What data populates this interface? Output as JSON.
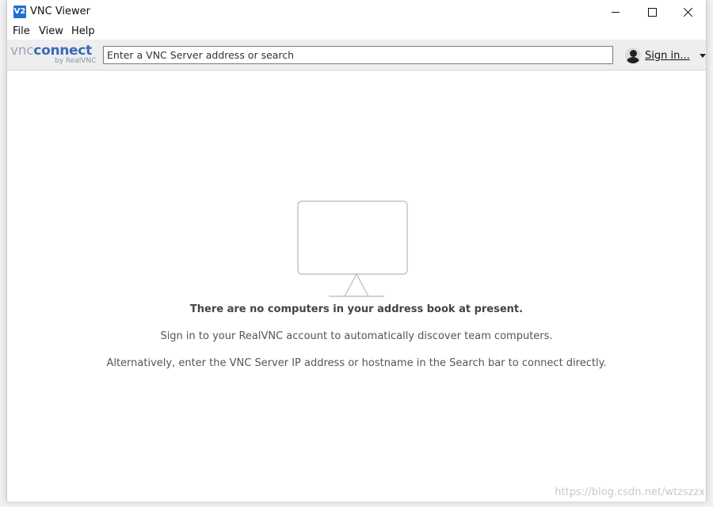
{
  "window": {
    "title": "VNC Viewer",
    "icon_text": "V2"
  },
  "menu": {
    "items": [
      "File",
      "View",
      "Help"
    ]
  },
  "toolbar": {
    "logo_vnc": "vnc",
    "logo_connect": "connect",
    "logo_byline": "by RealVNC",
    "search_placeholder": "Enter a VNC Server address or search",
    "search_value": "",
    "signin_label": "Sign in..."
  },
  "main": {
    "empty_title": "There are no computers in your address book at present.",
    "line1": "Sign in to your RealVNC account to automatically discover team computers.",
    "line2": "Alternatively, enter the VNC Server IP address or hostname in the Search bar to connect directly."
  },
  "watermark": "https://blog.csdn.net/wtzszzx",
  "colors": {
    "accent": "#1f6fd1",
    "logo_connect": "#3a6ab8",
    "toolbar_bg": "#eeeeee"
  },
  "icons": {
    "app": "vnc-viewer-icon",
    "user": "user-avatar-icon",
    "dropdown": "chevron-down-icon",
    "empty": "monitor-icon"
  }
}
